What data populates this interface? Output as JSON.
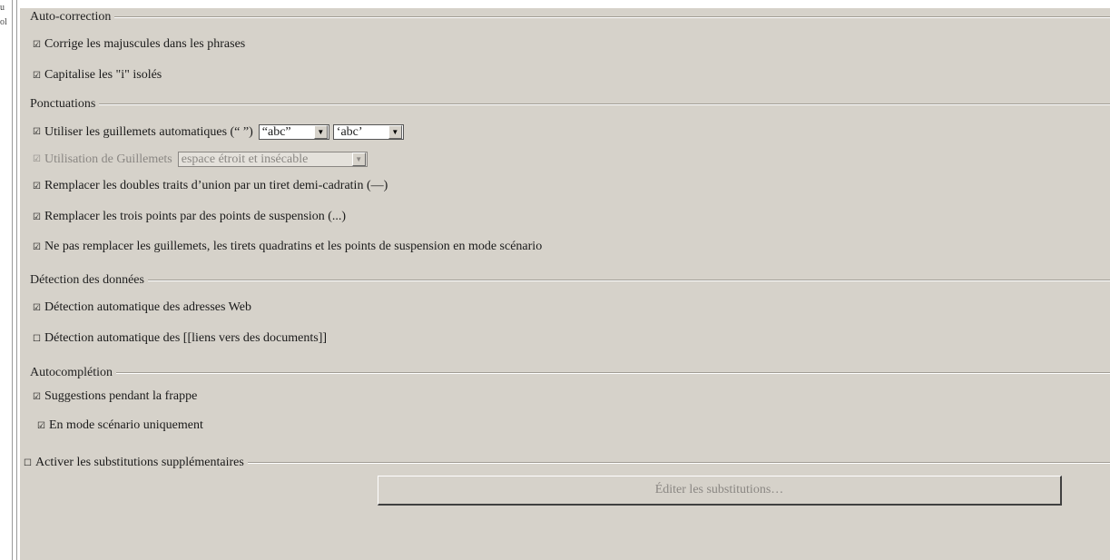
{
  "left_fragments": [
    "u",
    "ol"
  ],
  "groups": {
    "auto_correction": {
      "label": "Auto-correction",
      "items": [
        {
          "label": "Corrige les majuscules dans les phrases",
          "checked": true
        },
        {
          "label": "Capitalise les \"i\" isolés",
          "checked": true
        }
      ]
    },
    "punctuation": {
      "label": "Ponctuations",
      "quotes": {
        "label": "Utiliser les guillemets automatiques (“ ”)",
        "checked": true,
        "double_value": "“abc”",
        "single_value": "‘abc’"
      },
      "spacing": {
        "label": "Utilisation de Guillemets",
        "checked": true,
        "disabled": true,
        "value": "espace étroit et insécable"
      },
      "items": [
        {
          "label": "Remplacer les doubles traits d’union par un tiret demi-cadratin (—)",
          "checked": true
        },
        {
          "label": "Remplacer les trois points par des points de suspension (...)",
          "checked": true
        },
        {
          "label": "Ne pas remplacer les guillemets, les tirets quadratins et les points de suspension en mode scénario",
          "checked": true
        }
      ]
    },
    "data_detection": {
      "label": "Détection des données",
      "items": [
        {
          "label": "Détection automatique des adresses Web",
          "checked": true
        },
        {
          "label": "Détection automatique des [[liens vers des documents]]",
          "checked": false
        }
      ]
    },
    "autocompletion": {
      "label": "Autocomplétion",
      "items": [
        {
          "label": "Suggestions pendant la frappe",
          "checked": true
        },
        {
          "label": "En mode scénario uniquement",
          "checked": true
        }
      ]
    }
  },
  "substitutions": {
    "label": "Activer les substitutions supplémentaires",
    "checked": false,
    "edit_button": "Éditer les substitutions…"
  }
}
